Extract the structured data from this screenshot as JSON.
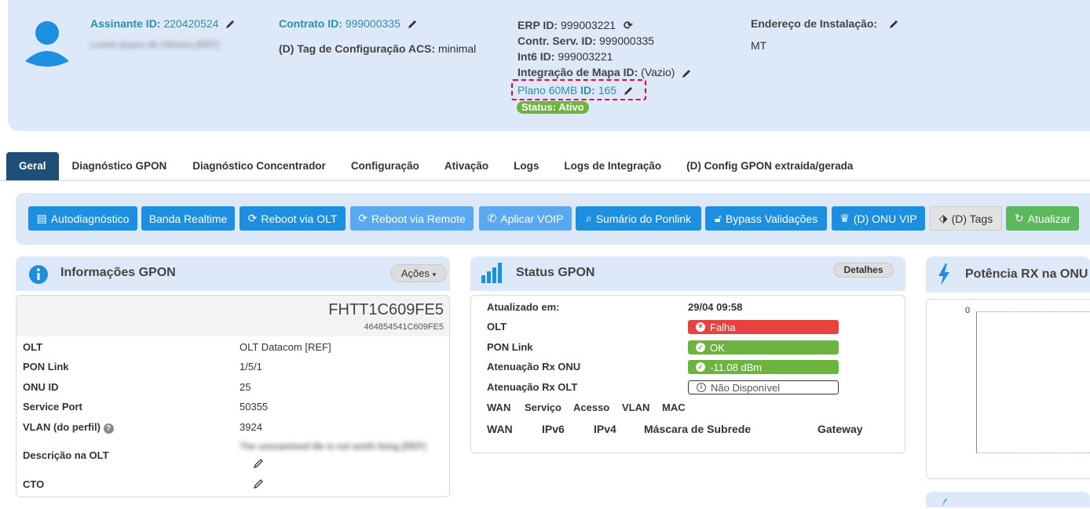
{
  "header": {
    "assinante_label": "Assinante ID:",
    "assinante_id": "220420524",
    "assinante_name": "Lorem Ipsum de Oliveira [REF]",
    "contrato_label": "Contrato ID:",
    "contrato_id": "999000335",
    "tag_label": "(D) Tag de Configuração ACS:",
    "tag_value": "minimal",
    "erp_label": "ERP ID:",
    "erp_value": "999003221",
    "contr_label": "Contr. Serv. ID:",
    "contr_value": "999000335",
    "int6_label": "Int6 ID:",
    "int6_value": "999003221",
    "mapa_label": "Integração de Mapa ID:",
    "mapa_value": "(Vazio)",
    "plano_name": "Plano 60MB",
    "plano_id_label": "ID:",
    "plano_id": "165",
    "status": "Status: Ativo",
    "endereco_label": "Endereço de Instalação:",
    "endereco_value": "MT"
  },
  "tabs": [
    "Geral",
    "Diagnóstico GPON",
    "Diagnóstico Concentrador",
    "Configuração",
    "Ativação",
    "Logs",
    "Logs de Integração",
    "(D) Config GPON extraída/gerada"
  ],
  "toolbar": [
    "Autodiagnóstico",
    "Banda Realtime",
    "Reboot via OLT",
    "Reboot via Remote",
    "Aplicar VOIP",
    "Sumário do Ponlink",
    "Bypass Validações",
    "(D) ONU VIP",
    "(D) Tags",
    "Atualizar"
  ],
  "info": {
    "title": "Informações GPON",
    "actions": "Ações",
    "serial": "FHTT1C609FE5",
    "serial_hex": "464854541C609FE5",
    "rows": [
      [
        "OLT",
        "OLT Datacom [REF]"
      ],
      [
        "PON Link",
        "1/5/1"
      ],
      [
        "ONU ID",
        "25"
      ],
      [
        "Service Port",
        "50355"
      ],
      [
        "VLAN (do perfil)",
        "3924"
      ],
      [
        "Descrição na OLT",
        "The unexamined life is not worth living [REF]"
      ],
      [
        "CTO",
        ""
      ]
    ]
  },
  "status": {
    "title": "Status GPON",
    "details": "Detalhes",
    "rows": [
      [
        "Atualizado em:",
        "29/04 09:58"
      ],
      [
        "OLT",
        "Falha"
      ],
      [
        "PON Link",
        "OK"
      ],
      [
        "Atenuação Rx ONU",
        "-11.08 dBm"
      ],
      [
        "Atenuação Rx OLT",
        "Não Disponível"
      ]
    ],
    "subtabs": [
      "WAN",
      "Serviço",
      "Acesso",
      "VLAN",
      "MAC"
    ],
    "cols": [
      "WAN",
      "IPv6",
      "IPv4",
      "Máscara de Subrede",
      "Gateway"
    ]
  },
  "potencia": {
    "title": "Potência RX na ONU",
    "ytick": "0"
  },
  "colors": {
    "accent": "#1d8fe1",
    "header_bg": "#dde9f9",
    "success": "#6cb33f",
    "danger": "#e9413f",
    "active_tab": "#1e4f78"
  }
}
